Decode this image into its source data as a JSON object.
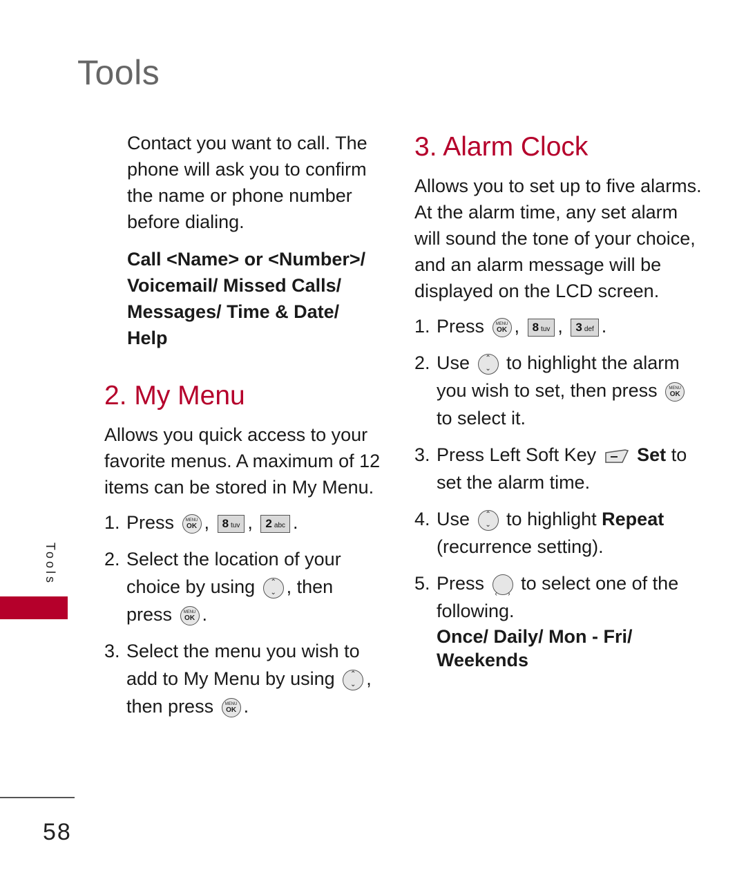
{
  "header": {
    "title": "Tools"
  },
  "left_column": {
    "continuation_text": "Contact you want to call. The phone will ask you to confirm the name or phone number before dialing.",
    "options_list": "Call <Name> or <Number>/ Voicemail/ Missed Calls/ Messages/ Time & Date/ Help",
    "my_menu": {
      "title": "2. My Menu",
      "intro": "Allows you quick access to your favorite menus. A maximum of 12 items can be stored in My Menu.",
      "steps": [
        {
          "num": "1.",
          "text_a": "Press",
          "sep1": ",",
          "key1": "8",
          "key1_letters": "tuv",
          "sep2": ",",
          "key2": "2",
          "key2_letters": "abc",
          "end": "."
        },
        {
          "num": "2.",
          "text_a": "Select the location of your choice by using",
          "text_b": ", then press",
          "end": "."
        },
        {
          "num": "3.",
          "text_a": "Select the menu you wish to add to My Menu by using",
          "text_b": ", then press",
          "end": "."
        }
      ]
    }
  },
  "right_column": {
    "alarm_clock": {
      "title": "3. Alarm Clock",
      "intro": "Allows you to set up to five alarms. At the alarm time, any set alarm will sound the tone of your choice, and an alarm message will be displayed on the LCD screen.",
      "steps": [
        {
          "num": "1.",
          "text_a": "Press",
          "sep1": ",",
          "key1": "8",
          "key1_letters": "tuv",
          "sep2": ",",
          "key2": "3",
          "key2_letters": "def",
          "end": "."
        },
        {
          "num": "2.",
          "text_a": "Use",
          "text_b": "to highlight the alarm you wish to set, then press",
          "text_c": "to select it."
        },
        {
          "num": "3.",
          "text_a": "Press Left Soft Key",
          "bold": "Set",
          "text_b": "to set the alarm time."
        },
        {
          "num": "4.",
          "text_a": "Use",
          "text_b": "to highlight",
          "bold": "Repeat",
          "text_c": "(recurrence setting)."
        },
        {
          "num": "5.",
          "text_a": "Press",
          "text_b": "to select one of the following.",
          "options": "Once/ Daily/ Mon - Fri/ Weekends"
        }
      ]
    }
  },
  "icons": {
    "menu_ok_top": "MENU",
    "menu_ok_bottom": "OK",
    "nav_up": "⌃",
    "nav_down": "⌄",
    "nav_left": "‹",
    "nav_right": "›"
  },
  "side_tab": {
    "label": "Tools",
    "color": "#b5002b"
  },
  "footer": {
    "page_number": "58"
  },
  "colors": {
    "accent": "#b5002b",
    "title_gray": "#666666"
  }
}
